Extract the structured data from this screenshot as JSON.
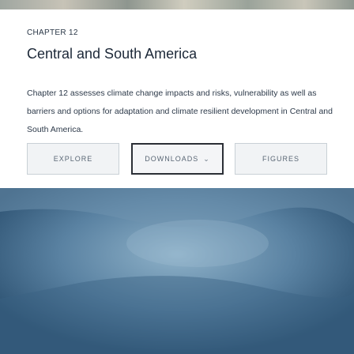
{
  "chapter": {
    "label": "CHAPTER 12",
    "title": "Central and South America",
    "description": "Chapter 12 assesses climate change impacts and risks, vulnerability as well as barriers and options for adaptation and climate resilient development in Central and South America."
  },
  "buttons": {
    "explore": "EXPLORE",
    "downloads": "DOWNLOADS",
    "figures": "FIGURES"
  },
  "icons": {
    "downloads_chevron": "chevron-down-icon"
  },
  "colors": {
    "text_primary": "#1c2838",
    "button_bg": "#f1f3f5",
    "button_border": "#c9d0d6",
    "active_border": "#2b2f36",
    "hero_sea": "#4f7898"
  }
}
